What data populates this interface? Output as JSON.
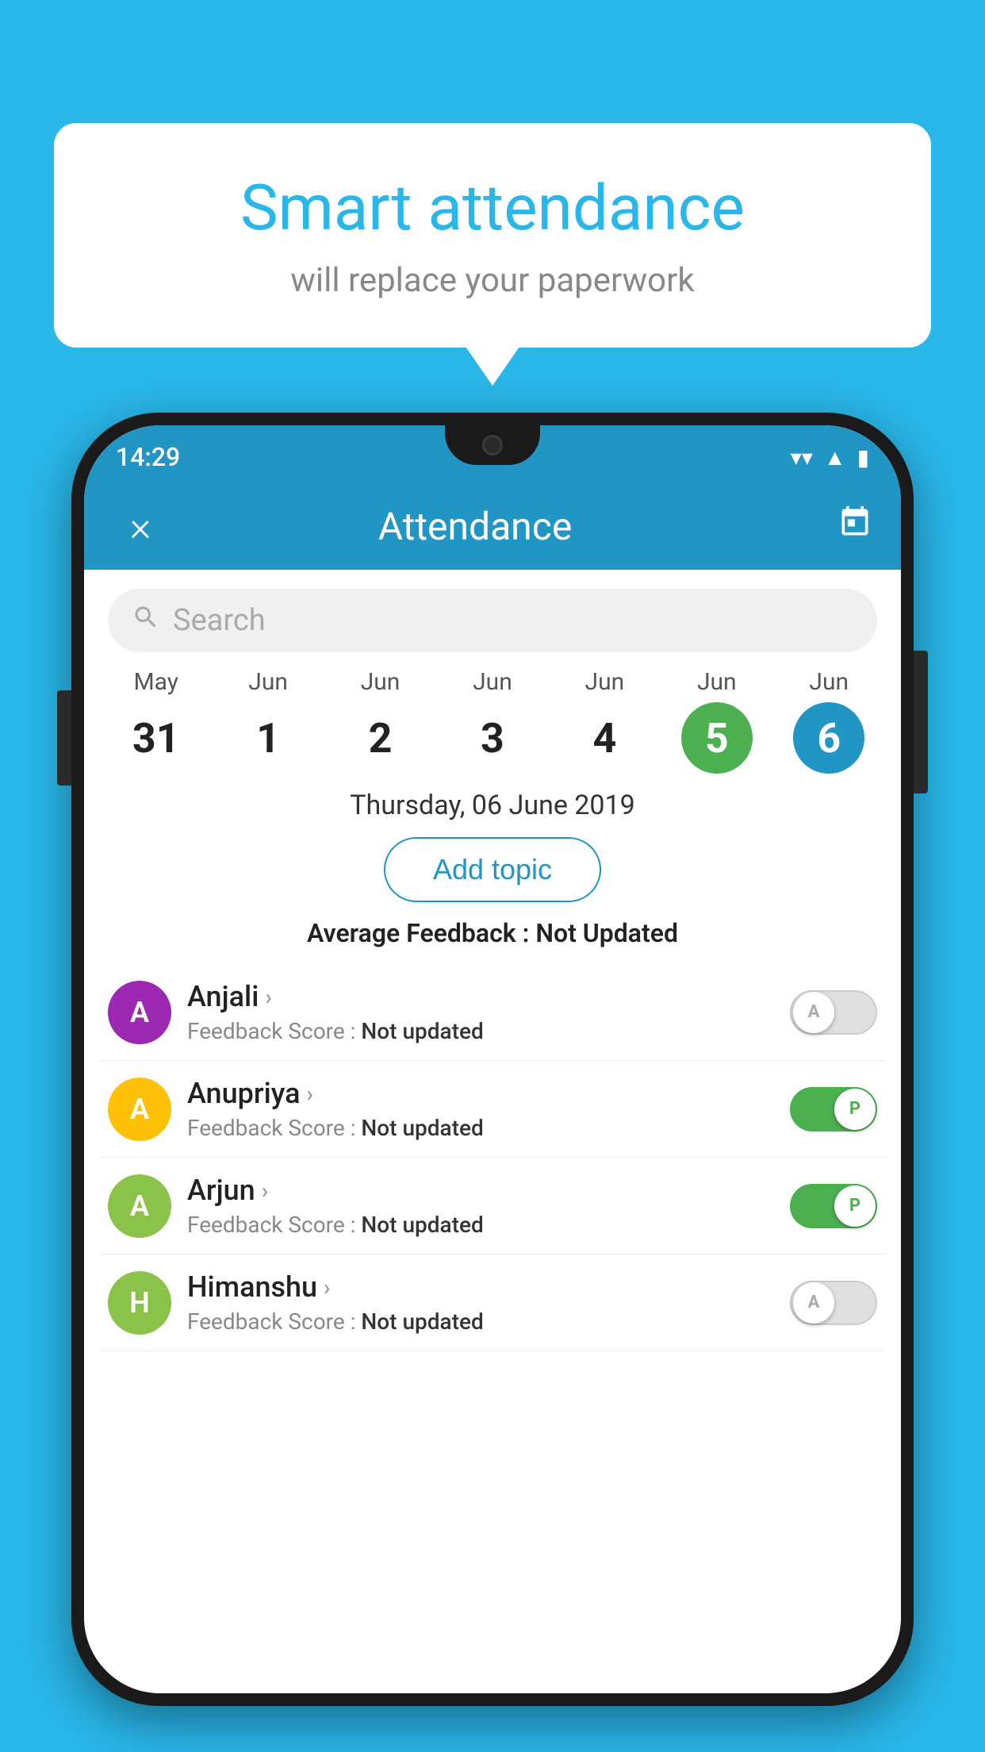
{
  "background": {
    "color": "#29b6e8"
  },
  "speech_bubble": {
    "title": "Smart attendance",
    "subtitle": "will replace your paperwork"
  },
  "status_bar": {
    "time": "14:29",
    "wifi": "▼",
    "signal": "▲",
    "battery": "▮"
  },
  "app_bar": {
    "close_label": "×",
    "title": "Attendance",
    "calendar_label": "📅"
  },
  "search": {
    "placeholder": "Search"
  },
  "dates": [
    {
      "month": "May",
      "day": "31",
      "state": "normal"
    },
    {
      "month": "Jun",
      "day": "1",
      "state": "normal"
    },
    {
      "month": "Jun",
      "day": "2",
      "state": "normal"
    },
    {
      "month": "Jun",
      "day": "3",
      "state": "normal"
    },
    {
      "month": "Jun",
      "day": "4",
      "state": "normal"
    },
    {
      "month": "Jun",
      "day": "5",
      "state": "today"
    },
    {
      "month": "Jun",
      "day": "6",
      "state": "selected"
    }
  ],
  "selected_date_label": "Thursday, 06 June 2019",
  "add_topic_label": "Add topic",
  "average_feedback_label": "Average Feedback : ",
  "average_feedback_value": "Not Updated",
  "students": [
    {
      "name": "Anjali",
      "avatar_letter": "A",
      "avatar_color": "#9c27b0",
      "feedback_label": "Feedback Score : ",
      "feedback_value": "Not updated",
      "toggle_state": "off",
      "toggle_letter": "A"
    },
    {
      "name": "Anupriya",
      "avatar_letter": "A",
      "avatar_color": "#ffc107",
      "feedback_label": "Feedback Score : ",
      "feedback_value": "Not updated",
      "toggle_state": "on",
      "toggle_letter": "P"
    },
    {
      "name": "Arjun",
      "avatar_letter": "A",
      "avatar_color": "#8bc34a",
      "feedback_label": "Feedback Score : ",
      "feedback_value": "Not updated",
      "toggle_state": "on",
      "toggle_letter": "P"
    },
    {
      "name": "Himanshu",
      "avatar_letter": "H",
      "avatar_color": "#8bc34a",
      "feedback_label": "Feedback Score : ",
      "feedback_value": "Not updated",
      "toggle_state": "off",
      "toggle_letter": "A"
    }
  ]
}
